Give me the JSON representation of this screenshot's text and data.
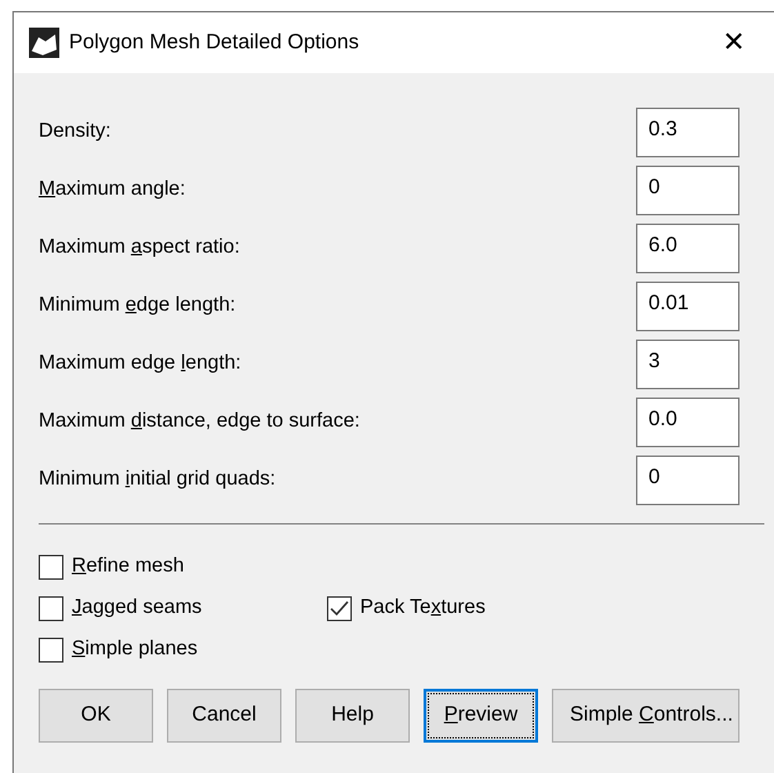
{
  "window": {
    "title": "Polygon Mesh Detailed Options",
    "close": "✕"
  },
  "fields": [
    {
      "label": {
        "post": "Density:"
      },
      "value": "0.3"
    },
    {
      "label": {
        "key": "M",
        "post": "aximum angle:"
      },
      "value": "0"
    },
    {
      "label": {
        "pre": "Maximum ",
        "key": "a",
        "post": "spect ratio:"
      },
      "value": "6.0"
    },
    {
      "label": {
        "pre": "Minimum ",
        "key": "e",
        "post": "dge length:"
      },
      "value": "0.01"
    },
    {
      "label": {
        "pre": "Maximum edge ",
        "key": "l",
        "post": "ength:"
      },
      "value": "3"
    },
    {
      "label": {
        "pre": "Maximum ",
        "key": "d",
        "post": "istance, edge to surface:"
      },
      "value": "0.0"
    },
    {
      "label": {
        "pre": "Minimum ",
        "key": "i",
        "post": "nitial grid quads:"
      },
      "value": "0"
    }
  ],
  "checkboxes": [
    [
      {
        "label": {
          "key": "R",
          "post": "efine mesh"
        },
        "checked": false
      }
    ],
    [
      {
        "label": {
          "key": "J",
          "post": "agged seams"
        },
        "checked": false
      },
      {
        "label": {
          "pre": "Pack Te",
          "key": "x",
          "post": "tures"
        },
        "checked": true
      }
    ],
    [
      {
        "label": {
          "key": "S",
          "post": "imple planes"
        },
        "checked": false
      }
    ]
  ],
  "buttons": [
    {
      "label": {
        "post": "OK"
      },
      "focused": false
    },
    {
      "label": {
        "post": "Cancel"
      },
      "focused": false
    },
    {
      "label": {
        "post": "Help"
      },
      "focused": false
    },
    {
      "label": {
        "key": "P",
        "post": "review"
      },
      "focused": true
    },
    {
      "label": {
        "pre": "Simple ",
        "key": "C",
        "post": "ontrols..."
      },
      "focused": false
    }
  ]
}
